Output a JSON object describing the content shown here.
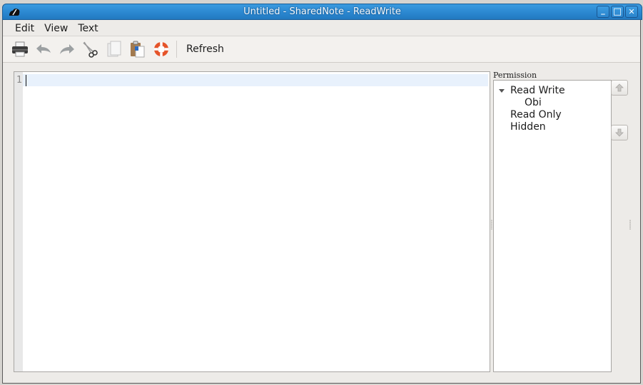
{
  "window": {
    "title": "Untitled - SharedNote - ReadWrite",
    "app_icon": "sharednote-app-icon",
    "controls": {
      "minimize_glyph": "_",
      "maximize_glyph": "□",
      "close_glyph": "✕"
    }
  },
  "menubar": {
    "items": [
      {
        "label": "Edit"
      },
      {
        "label": "View"
      },
      {
        "label": "Text"
      }
    ]
  },
  "toolbar": {
    "icons": [
      {
        "name": "print-icon"
      },
      {
        "name": "undo-icon"
      },
      {
        "name": "redo-icon"
      },
      {
        "name": "cut-icon"
      },
      {
        "name": "copy-icon"
      },
      {
        "name": "paste-icon"
      },
      {
        "name": "help-icon"
      }
    ],
    "refresh_label": "Refresh"
  },
  "editor": {
    "line_numbers": [
      "1"
    ],
    "content": ""
  },
  "permission_panel": {
    "label": "Permission",
    "tree": [
      {
        "label": "Read Write",
        "expanded": true,
        "children": [
          {
            "label": "Obi"
          }
        ]
      },
      {
        "label": "Read Only",
        "children": []
      },
      {
        "label": "Hidden",
        "children": []
      }
    ],
    "move_up_icon": "arrow-up-icon",
    "move_down_icon": "arrow-down-icon"
  }
}
